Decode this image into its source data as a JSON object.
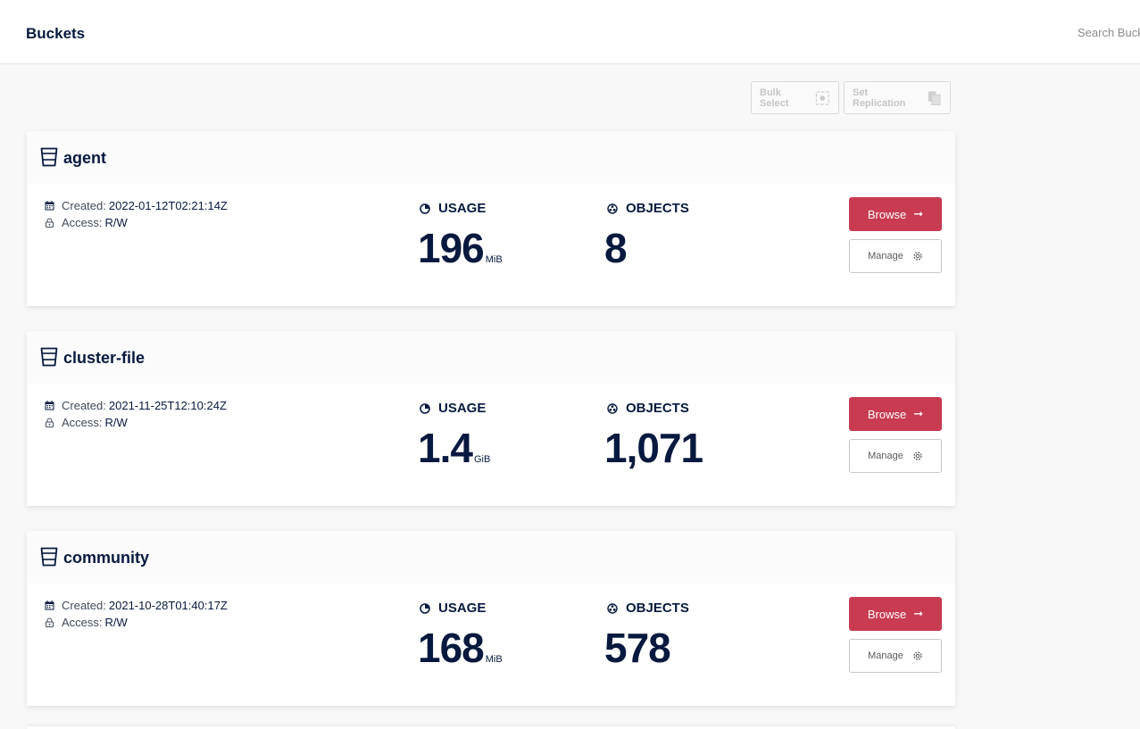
{
  "header": {
    "title": "Buckets",
    "search_placeholder": "Search Buckets"
  },
  "toolbar": {
    "bulk_select_label": "Bulk Select",
    "set_replication_label": "Set Replication"
  },
  "labels": {
    "created": "Created:",
    "access": "Access:",
    "usage": "USAGE",
    "objects": "OBJECTS",
    "browse": "Browse",
    "manage": "Manage"
  },
  "buckets": [
    {
      "name": "agent",
      "created": "2022-01-12T02:21:14Z",
      "access": "R/W",
      "usage_value": "196",
      "usage_unit": "MiB",
      "objects": "8"
    },
    {
      "name": "cluster-file",
      "created": "2021-11-25T12:10:24Z",
      "access": "R/W",
      "usage_value": "1.4",
      "usage_unit": "GiB",
      "objects": "1,071"
    },
    {
      "name": "community",
      "created": "2021-10-28T01:40:17Z",
      "access": "R/W",
      "usage_value": "168",
      "usage_unit": "MiB",
      "objects": "578"
    }
  ],
  "colors": {
    "accent": "#c83b51",
    "text_primary": "#07193e",
    "background": "#f8f8f8"
  },
  "icons": {
    "bucket": "bucket-icon",
    "calendar": "calendar-icon",
    "lock": "lock-icon",
    "usage": "pie-chart-icon",
    "objects": "objects-icon",
    "arrow": "arrow-right-icon",
    "gear": "gear-icon"
  }
}
